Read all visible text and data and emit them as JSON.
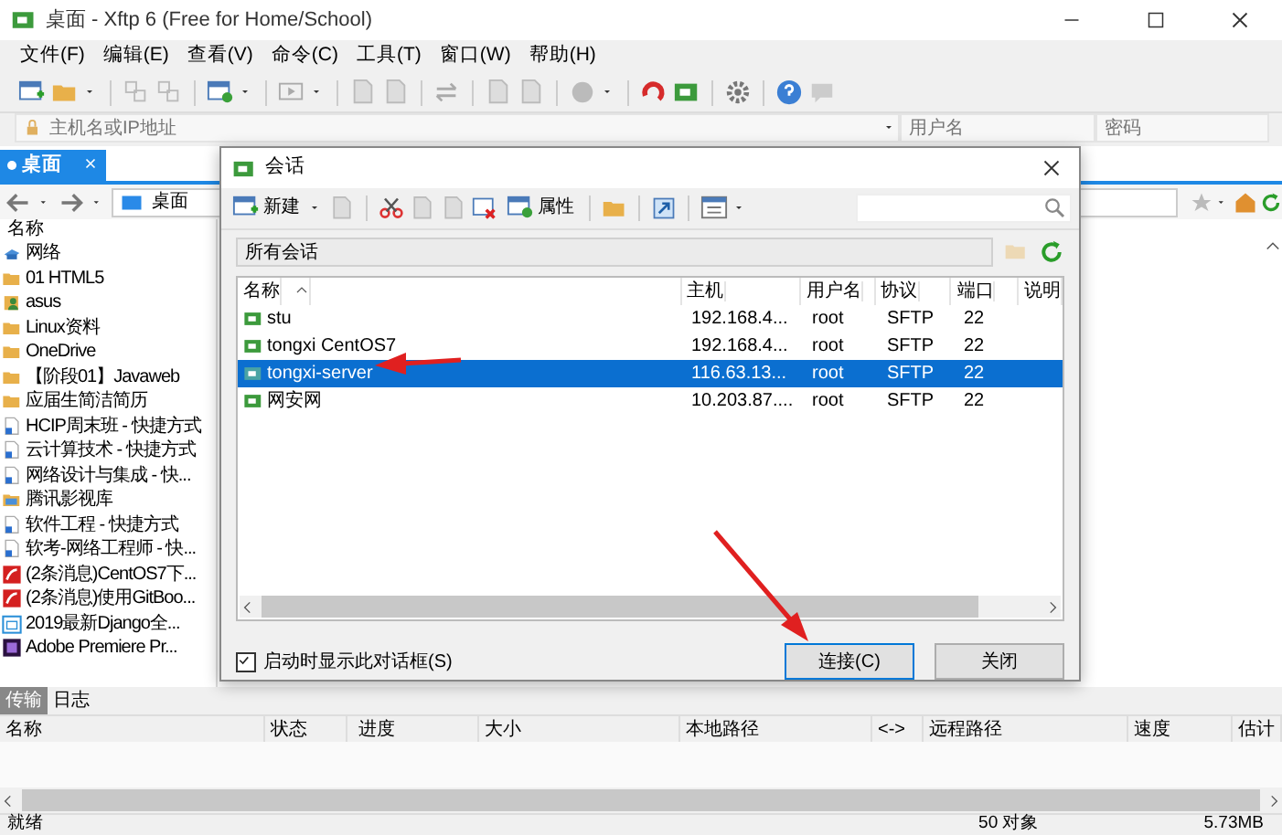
{
  "window": {
    "title": "桌面 - Xftp 6 (Free for Home/School)"
  },
  "menu": [
    "文件(F)",
    "编辑(E)",
    "查看(V)",
    "命令(C)",
    "工具(T)",
    "窗口(W)",
    "帮助(H)"
  ],
  "address_bar": {
    "host_placeholder": "主机名或IP地址",
    "user_placeholder": "用户名",
    "password_placeholder": "密码"
  },
  "tabs": [
    {
      "label": "桌面",
      "selected": true
    }
  ],
  "path": "桌面",
  "file_list": {
    "column": "名称",
    "items": [
      {
        "name": "网络",
        "kind": "network"
      },
      {
        "name": "01 HTML5",
        "kind": "folder"
      },
      {
        "name": "asus",
        "kind": "user"
      },
      {
        "name": "Linux资料",
        "kind": "folder"
      },
      {
        "name": "OneDrive",
        "kind": "folder"
      },
      {
        "name": "【阶段01】Javaweb",
        "kind": "folder"
      },
      {
        "name": "应届生简洁简历",
        "kind": "folder"
      },
      {
        "name": "HCIP周末班 - 快捷方式",
        "kind": "shortcut"
      },
      {
        "name": "云计算技术 - 快捷方式",
        "kind": "shortcut"
      },
      {
        "name": "网络设计与集成 - 快...",
        "kind": "shortcut"
      },
      {
        "name": "腾讯影视库",
        "kind": "media"
      },
      {
        "name": "软件工程 - 快捷方式",
        "kind": "shortcut"
      },
      {
        "name": "软考-网络工程师 - 快...",
        "kind": "shortcut"
      },
      {
        "name": "(2条消息)CentOS7下...",
        "kind": "web"
      },
      {
        "name": "(2条消息)使用GitBoo...",
        "kind": "web"
      },
      {
        "name": "2019最新Django全...",
        "kind": "calendar"
      },
      {
        "name": "Adobe Premiere Pr...",
        "kind": "app"
      }
    ]
  },
  "dialog": {
    "title": "会话",
    "new_label": "新建",
    "properties_label": "属性",
    "breadcrumb": "所有会话",
    "columns": [
      "名称",
      "主机",
      "用户名",
      "协议",
      "端口",
      "说明"
    ],
    "rows": [
      {
        "name": "stu",
        "host": "192.168.4...",
        "user": "root",
        "protocol": "SFTP",
        "port": "22",
        "selected": false
      },
      {
        "name": "tongxi CentOS7",
        "host": "192.168.4...",
        "user": "root",
        "protocol": "SFTP",
        "port": "22",
        "selected": false
      },
      {
        "name": "tongxi-server",
        "host": "116.63.13...",
        "user": "root",
        "protocol": "SFTP",
        "port": "22",
        "selected": true
      },
      {
        "name": "网安网",
        "host": "10.203.87....",
        "user": "root",
        "protocol": "SFTP",
        "port": "22",
        "selected": false
      }
    ],
    "show_on_startup": {
      "label": "启动时显示此对话框(S)",
      "checked": true
    },
    "buttons": [
      "连接(C)",
      "关闭"
    ]
  },
  "transfer": {
    "tabs": [
      {
        "label": "传输",
        "selected": true
      },
      {
        "label": "日志",
        "selected": false
      }
    ],
    "columns": [
      "名称",
      "状态",
      "进度",
      "大小",
      "本地路径",
      "<->",
      "远程路径",
      "速度",
      "估计"
    ]
  },
  "status_bar": {
    "text": "就绪",
    "objects": "50 对象",
    "size": "5.73MB"
  }
}
